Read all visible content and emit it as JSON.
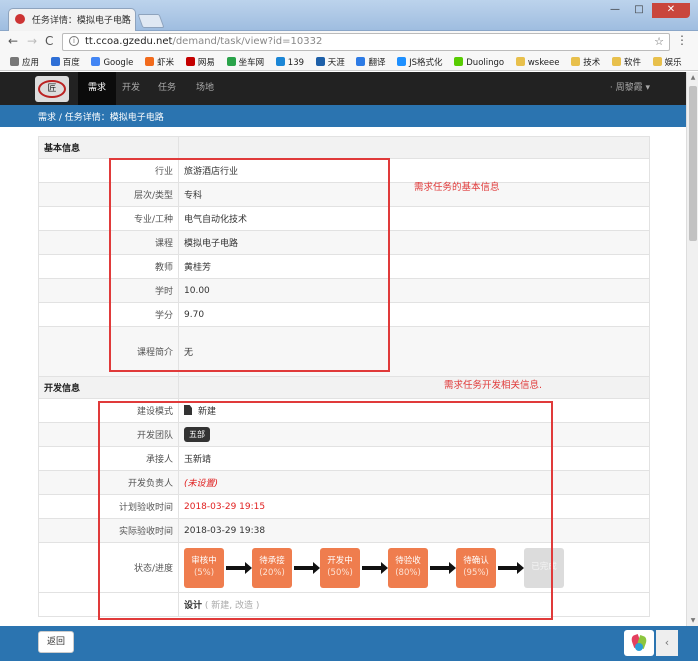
{
  "browser": {
    "tab_title": "任务详情：模拟电子电路",
    "tab_close": "×",
    "url_host": "tt.ccoa.gzedu.net",
    "url_path": "/demand/task/view?id=10332",
    "nav_back": "←",
    "nav_forward": "→",
    "nav_reload": "C",
    "star": "☆",
    "menu": "⋮",
    "win_min": "—",
    "win_max": "□",
    "win_close": "✕",
    "bookmarks": [
      "应用",
      "百度",
      "Google",
      "虾米",
      "网易",
      "坐车网",
      "139",
      "天涯",
      "翻译",
      "JS格式化",
      "Duolingo",
      "wskeee",
      "技术",
      "软件",
      "娱乐"
    ]
  },
  "site": {
    "logo_text": "匠",
    "nav": [
      "需求",
      "开发",
      "任务",
      "场地"
    ],
    "user": "· 周黎霞 ▾"
  },
  "breadcrumb": "需求 /  任务详情：模拟电子电路",
  "basic": {
    "section_title": "基本信息",
    "rows": [
      {
        "label": "行业",
        "value": "旅游酒店行业"
      },
      {
        "label": "层次/类型",
        "value": "专科"
      },
      {
        "label": "专业/工种",
        "value": "电气自动化技术"
      },
      {
        "label": "课程",
        "value": "模拟电子电路"
      },
      {
        "label": "教师",
        "value": "黄桂芳"
      },
      {
        "label": "学时",
        "value": "10.00"
      },
      {
        "label": "学分",
        "value": "9.70"
      },
      {
        "label": "课程简介",
        "value": "无"
      }
    ]
  },
  "dev": {
    "section_title": "开发信息",
    "mode_label": "建设模式",
    "mode_value": "新建",
    "team_label": "开发团队",
    "team_value": "五部",
    "taker_label": "承接人",
    "taker_value": "玉新靖",
    "lead_label": "开发负责人",
    "lead_value": "(未设置)",
    "plan_label": "计划验收时间",
    "plan_value": "2018-03-29 19:15",
    "actual_label": "实际验收时间",
    "actual_value": "2018-03-29 19:38",
    "status_label": "状态/进度",
    "steps": [
      {
        "name": "审核中",
        "pct": "(5%)"
      },
      {
        "name": "待承接",
        "pct": "(20%)"
      },
      {
        "name": "开发中",
        "pct": "(50%)"
      },
      {
        "name": "待验收",
        "pct": "(80%)"
      },
      {
        "name": "待确认",
        "pct": "(95%)"
      }
    ],
    "final_step": "已完成",
    "design_label": "设计",
    "design_note": "( 新建, 改造 )"
  },
  "annotations": {
    "basic_note": "需求任务的基本信息",
    "dev_note": "需求任务开发相关信息.",
    "color": "#e03a3a"
  },
  "footer": {
    "back": "返回",
    "collapse": "‹"
  },
  "colors": {
    "nav_bg": "#222222",
    "breadcrumb_bg": "#2b74b0",
    "step_active": "#ef7d4e",
    "step_disabled": "#dcdcdc"
  }
}
